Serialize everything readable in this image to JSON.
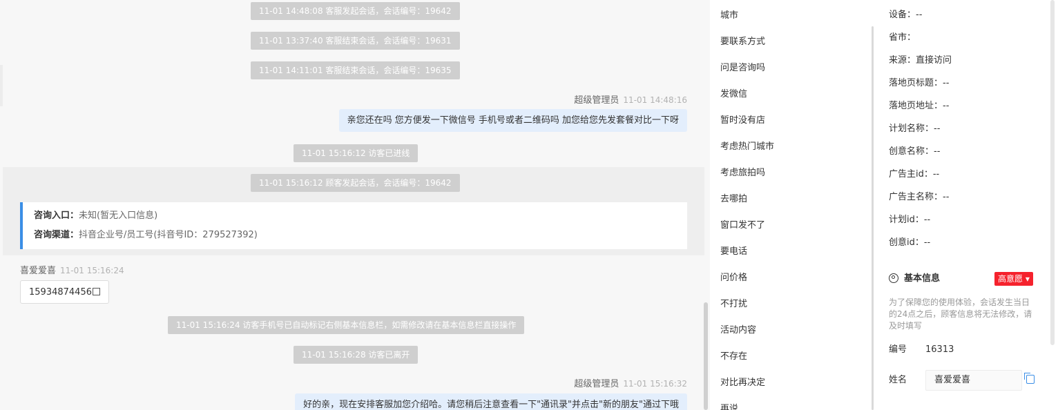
{
  "chat": {
    "system_messages": [
      "11-01 14:48:08 客服发起会话，会话编号：19642",
      "11-01 13:37:40 客服结束会话，会话编号：19631",
      "11-01 14:11:01 客服结束会话，会话编号：19635",
      "11-01 15:16:12 访客已进线",
      "11-01 15:16:12 顾客发起会话，会话编号：19642",
      "11-01 15:16:24 访客手机号已自动标记右侧基本信息栏，如需修改请在基本信息栏直接操作",
      "11-01 15:16:28 访客已离开"
    ],
    "agent_name": "超级管理员",
    "agent_message_1": {
      "time": "11-01 14:48:16",
      "text": "亲您还在吗 您方便发一下微信号 手机号或者二维码吗 加您给您先发套餐对比一下呀"
    },
    "entry": {
      "label_entry": "咨询入口：",
      "value_entry": "未知(暂无入口信息)",
      "label_channel": "咨询渠道：",
      "value_channel": "抖音企业号/员工号(抖音号ID：279527392)"
    },
    "visitor_name": "喜爱爱喜",
    "visitor_time": "11-01 15:16:24",
    "visitor_phone": "15934874456",
    "agent_message_2": {
      "time": "11-01 15:16:32",
      "text": "好的亲，现在安排客服加您介绍哈。请您稍后注意查看一下\"通讯录\"并点击\"新的朋友\"通过下哦"
    }
  },
  "quick_replies": [
    "城市",
    "要联系方式",
    "问是咨询吗",
    "发微信",
    "暂时没有店",
    "考虑热门城市",
    "考虑旅拍吗",
    "去哪拍",
    "窗口发不了",
    "要电话",
    "问价格",
    "不打扰",
    "活动内容",
    "不存在",
    "对比再决定",
    "再说"
  ],
  "info": {
    "lines": [
      "设备：--",
      "省市：",
      "来源：直接访问",
      "落地页标题：--",
      "落地页地址：--",
      "计划名称：--",
      "创意名称：--",
      "广告主id：--",
      "广告主名称：--",
      "计划id：--",
      "创意id：--"
    ],
    "section_title": "基本信息",
    "intent_badge": "高意愿 ▾",
    "notice": "为了保障您的使用体验，会话发生当日的24点之后，顾客信息将无法修改，请及时填写",
    "id_label": "编号",
    "id_value": "16313",
    "name_label": "姓名",
    "name_value": "喜爱爱喜"
  },
  "colors": {
    "accent": "#3a8ee6",
    "badge": "#f5222d",
    "bubble": "#e3eefc",
    "system": "#cfcfcf"
  }
}
